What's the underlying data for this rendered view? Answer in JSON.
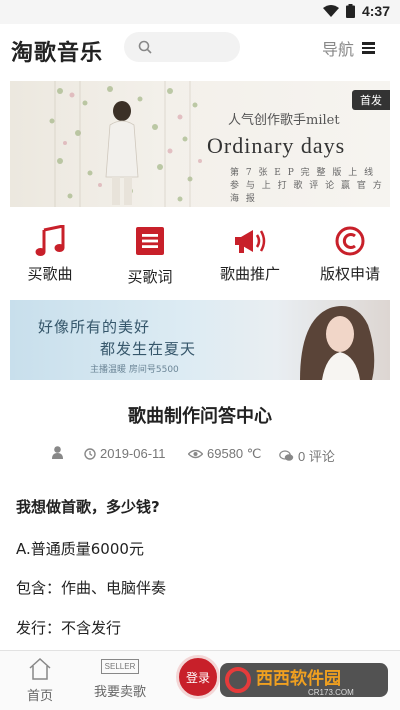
{
  "status_bar": {
    "time": "4:37"
  },
  "header": {
    "app_title": "淘歌音乐",
    "search_placeholder": "",
    "nav_label": "导航"
  },
  "banner_top": {
    "badge": "首发",
    "line1": "人气创作歌手milet",
    "line2": "Ordinary days",
    "line3a": "第 7 张 E P 完 整 版 上 线",
    "line3b": "参 与 上 打 歌 评 论 赢 官 方 海 报"
  },
  "categories": [
    {
      "label": "买歌曲",
      "icon": "music-note-icon"
    },
    {
      "label": "买歌词",
      "icon": "list-icon"
    },
    {
      "label": "歌曲推广",
      "icon": "megaphone-icon"
    },
    {
      "label": "版权申请",
      "icon": "copyright-icon"
    }
  ],
  "banner_second": {
    "line1": "好像所有的美好",
    "line2": "都发生在夏天",
    "line3": "主播温暖 房间号5500"
  },
  "article": {
    "title": "歌曲制作问答中心",
    "author": "",
    "date": "2019-06-11",
    "views": "69580 ℃",
    "comments": "0 评论"
  },
  "content": {
    "question": "我想做首歌，多少钱?",
    "line1": "A.普通质量6000元",
    "line2": "包含：作曲、电脑伴奏",
    "line3": "发行：不含发行"
  },
  "bottom_nav": {
    "home": "首页",
    "seller_icon_text": "SELLER",
    "sell": "我要卖歌",
    "login": "登录"
  },
  "watermark": {
    "brand": "西西软件园",
    "url": "CR173.COM"
  },
  "colors": {
    "accent_red": "#c8202a",
    "text_dark": "#222222",
    "text_muted": "#777777"
  }
}
